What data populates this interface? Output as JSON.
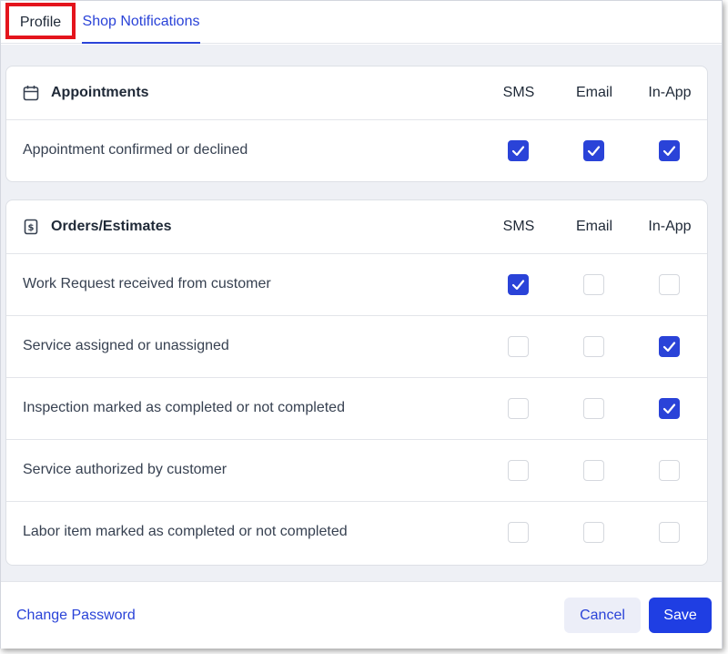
{
  "tabs": {
    "profile": "Profile",
    "shop_notifications": "Shop Notifications"
  },
  "columns": {
    "sms": "SMS",
    "email": "Email",
    "inapp": "In-App"
  },
  "colors": {
    "accent": "#2a43d8",
    "highlight": "#e4141c"
  },
  "sections": [
    {
      "title": "Appointments",
      "icon": "calendar-icon",
      "items": [
        {
          "label": "Appointment confirmed or declined",
          "sms": true,
          "email": true,
          "inapp": true
        }
      ]
    },
    {
      "title": "Orders/Estimates",
      "icon": "dollar-document-icon",
      "items": [
        {
          "label": "Work Request received from customer",
          "sms": true,
          "email": false,
          "inapp": false
        },
        {
          "label": "Service assigned or unassigned",
          "sms": false,
          "email": false,
          "inapp": true
        },
        {
          "label": "Inspection marked as completed or not completed",
          "sms": false,
          "email": false,
          "inapp": true
        },
        {
          "label": "Service authorized by customer",
          "sms": false,
          "email": false,
          "inapp": false
        },
        {
          "label": "Labor item marked as completed or not completed",
          "sms": false,
          "email": false,
          "inapp": false
        }
      ]
    }
  ],
  "footer": {
    "change_password": "Change Password",
    "cancel": "Cancel",
    "save": "Save"
  }
}
